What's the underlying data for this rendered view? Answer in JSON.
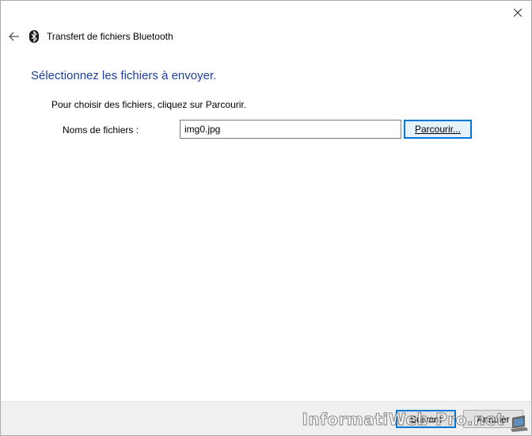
{
  "window": {
    "title": "Transfert de fichiers Bluetooth",
    "close_icon": "close-icon",
    "back_icon": "back-arrow-icon",
    "app_icon": "bluetooth-icon"
  },
  "main": {
    "heading": "Sélectionnez les fichiers à envoyer.",
    "instruction": "Pour choisir des fichiers, cliquez sur Parcourir.",
    "field_label": "Noms de fichiers :",
    "file_value": "img0.jpg",
    "browse_label": "Parcourir..."
  },
  "footer": {
    "next_label": "Suivant",
    "cancel_label": "Annuler"
  },
  "watermark": {
    "text": "InformatiWeb-Pro.net"
  },
  "colors": {
    "heading": "#1e3f9e",
    "accent": "#0078d7",
    "footer_bg": "#f0f0f0"
  }
}
